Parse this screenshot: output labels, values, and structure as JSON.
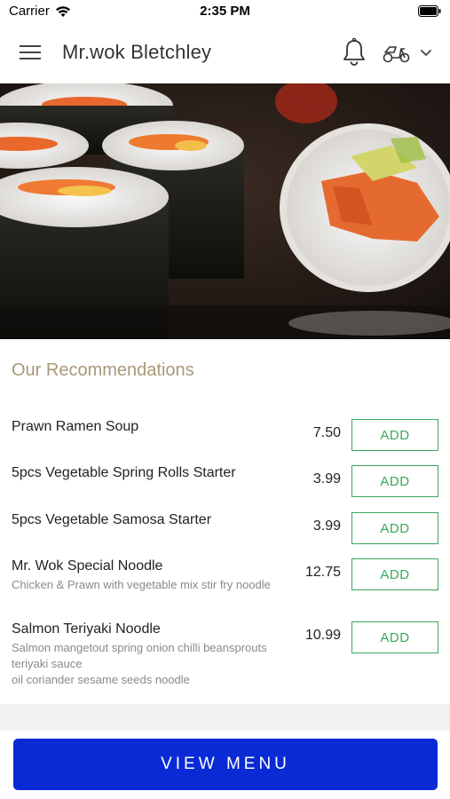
{
  "status_bar": {
    "carrier": "Carrier",
    "time": "2:35 PM"
  },
  "header": {
    "title": "Mr.wok Bletchley",
    "icons": [
      "menu-icon",
      "bell-icon",
      "scooter-icon",
      "chevron-down-icon"
    ]
  },
  "recommendations": {
    "title": "Our Recommendations",
    "add_label": "ADD",
    "items": [
      {
        "name": "Prawn Ramen Soup",
        "description": "",
        "price": "7.50"
      },
      {
        "name": "5pcs Vegetable Spring Rolls Starter",
        "description": "",
        "price": "3.99"
      },
      {
        "name": "5pcs Vegetable Samosa Starter",
        "description": "",
        "price": "3.99"
      },
      {
        "name": "Mr. Wok Special Noodle",
        "description": "Chicken & Prawn with vegetable mix stir fry noodle",
        "price": "12.75"
      },
      {
        "name": "Salmon Teriyaki Noodle",
        "description": "Salmon mangetout spring onion chilli beansprouts teriyaki sauce\noil coriander sesame seeds noodle",
        "price": "10.99"
      }
    ]
  },
  "footer": {
    "view_menu_label": "VIEW MENU"
  },
  "colors": {
    "accent_blue": "#0a2ad6",
    "add_green": "#39a85a",
    "section_title": "#a7987a"
  }
}
